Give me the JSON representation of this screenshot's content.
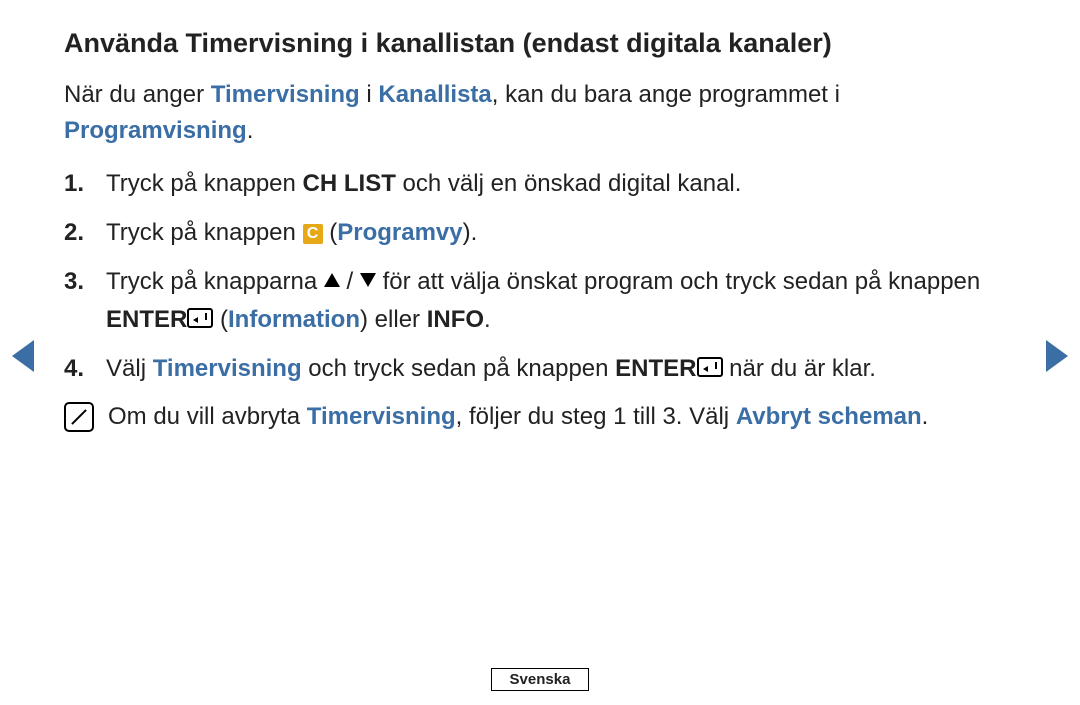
{
  "title": "Använda Timervisning i kanallistan (endast digitala kanaler)",
  "intro": {
    "p1": "När du anger ",
    "term1": "Timervisning",
    "p2": " i ",
    "term2": "Kanallista",
    "p3": ", kan du bara ange programmet i ",
    "term3": "Programvisning",
    "p4": "."
  },
  "steps": {
    "s1_num": "1.",
    "s1_a": "Tryck på knappen ",
    "s1_bold": "CH LIST",
    "s1_b": " och välj en önskad digital kanal.",
    "s2_num": "2.",
    "s2_a": "Tryck på knappen ",
    "s2_badge": "C",
    "s2_b": " (",
    "s2_term": "Programvy",
    "s2_c": ").",
    "s3_num": "3.",
    "s3_a": "Tryck på knapparna ",
    "s3_b": " / ",
    "s3_c": " för att välja önskat program och tryck sedan på knappen ",
    "s3_bold": "ENTER",
    "s3_d": " (",
    "s3_term": "Information",
    "s3_e": ") eller ",
    "s3_bold2": "INFO",
    "s3_f": ".",
    "s4_num": "4.",
    "s4_a": "Välj ",
    "s4_term": "Timervisning",
    "s4_b": " och tryck sedan på knappen ",
    "s4_bold": "ENTER",
    "s4_c": " när du är klar."
  },
  "note": {
    "a": "Om du vill avbryta ",
    "term1": "Timervisning",
    "b": ", följer du steg 1 till 3. Välj ",
    "term2": "Avbryt scheman",
    "c": "."
  },
  "footer": "Svenska"
}
